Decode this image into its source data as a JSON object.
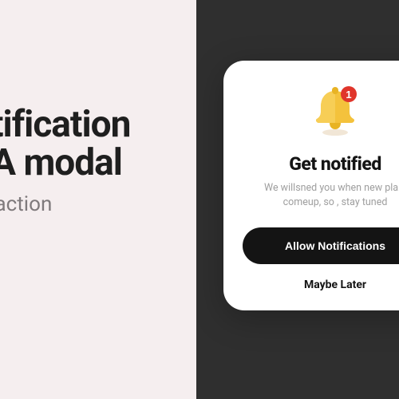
{
  "promo": {
    "title_line1": "otification",
    "title_line2": "TA modal",
    "subtitle": "to action"
  },
  "modal": {
    "title": "Get notified",
    "description": "We willsned you when new pla...\ncomeup, so , stay tuned",
    "primary_button": "Allow Notifications",
    "secondary_link": "Maybe Later"
  },
  "icons": {
    "bell": "bell-icon",
    "badge_count": "1"
  },
  "colors": {
    "left_bg": "#f5eeef",
    "right_bg": "#2f2f2f",
    "modal_bg": "#ffffff",
    "primary_btn_bg": "#141414",
    "bell_fill": "#f4c23c",
    "badge_fill": "#e0352b"
  }
}
